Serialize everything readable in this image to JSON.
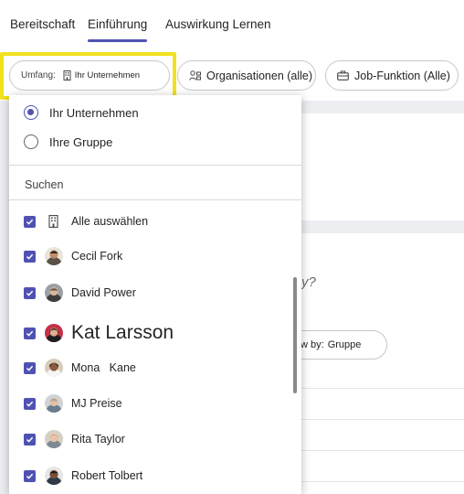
{
  "tabs": [
    {
      "label": "Bereitschaft",
      "active": false
    },
    {
      "label": "Einführung",
      "active": true
    },
    {
      "label": "Auswirkung Lernen",
      "active": false
    }
  ],
  "filters": {
    "scope": {
      "label": "Umfang:",
      "value": "Ihr Unternehmen",
      "icon": "building-icon"
    },
    "organizations": {
      "label": "Organisationen (alle)",
      "icon": "people-org-icon"
    },
    "job": {
      "label": "Job-Funktion (Alle)",
      "icon": "briefcase-icon"
    }
  },
  "dropdown": {
    "options": [
      {
        "label": "Ihr Unternehmen",
        "selected": true
      },
      {
        "label": "Ihre Gruppe",
        "selected": false
      }
    ],
    "search_label": "Suchen",
    "select_all": {
      "label": "Alle auswählen",
      "checked": true,
      "icon": "building-icon"
    },
    "people": [
      {
        "name": "Cecil Fork",
        "checked": true
      },
      {
        "name": "David Power",
        "checked": true
      },
      {
        "name": "Kat Larsson",
        "checked": true
      },
      {
        "name": "Mona   Kane",
        "checked": true
      },
      {
        "name": "MJ Preise",
        "checked": true
      },
      {
        "name": "Rita Taylor",
        "checked": true
      },
      {
        "name": "Robert Tolbert",
        "checked": true
      }
    ]
  },
  "background": {
    "question_mark": "y?",
    "view_by": {
      "label": "w by:",
      "value": "Gruppe"
    }
  },
  "colors": {
    "accent": "#4f52b2",
    "highlight": "#f2e21e",
    "page_background": "#edeef2"
  }
}
